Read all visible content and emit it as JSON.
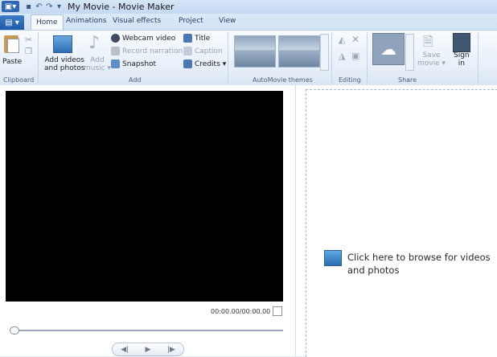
{
  "window": {
    "title": "My Movie - Movie Maker"
  },
  "tabs": [
    {
      "label": "Home"
    },
    {
      "label": "Animations"
    },
    {
      "label": "Visual effects"
    },
    {
      "label": "Project"
    },
    {
      "label": "View"
    }
  ],
  "ribbon": {
    "clipboard": {
      "paste_label": "Paste",
      "group_label": "Clipboard"
    },
    "add": {
      "add_videos_label": "Add videos",
      "add_videos_label2": "and photos",
      "add_music_label": "Add",
      "add_music_label2": "music",
      "webcam_label": "Webcam video",
      "narration_label": "Record narration",
      "snapshot_label": "Snapshot",
      "title_label": "Title",
      "caption_label": "Caption",
      "credits_label": "Credits",
      "group_label": "Add"
    },
    "themes": {
      "group_label": "AutoMovie themes"
    },
    "editing": {
      "group_label": "Editing"
    },
    "share": {
      "save_movie_label": "Save",
      "save_movie_label2": "movie",
      "sign_in_label": "Sign",
      "sign_in_label2": "in",
      "group_label": "Share"
    }
  },
  "preview": {
    "time": "00:00.00/00:00.00"
  },
  "storyboard": {
    "browse_text": "Click here to browse for videos and photos"
  },
  "colors": {
    "ribbon_bg": "#e6eef8",
    "video_bg": "#000000",
    "accent": "#1f5aa8"
  }
}
